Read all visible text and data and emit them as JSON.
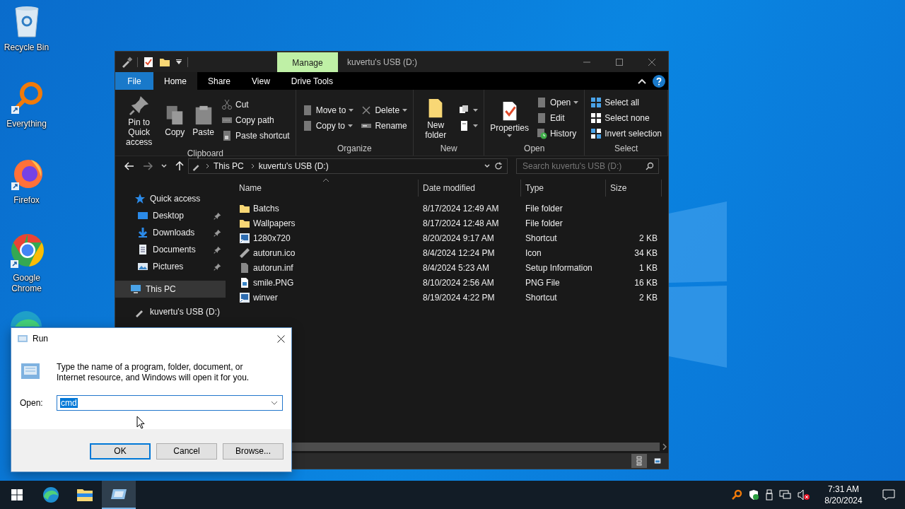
{
  "desktop_icons": [
    {
      "label": "Recycle Bin",
      "kind": "bin"
    },
    {
      "label": "Everything",
      "kind": "search"
    },
    {
      "label": "Firefox",
      "kind": "firefox"
    },
    {
      "label": "Google Chrome",
      "kind": "chrome"
    }
  ],
  "explorer": {
    "context_tab": "Manage",
    "title": "kuvertu's USB (D:)",
    "ribbon_tabs": [
      {
        "label": "File",
        "kind": "file",
        "selected": false
      },
      {
        "label": "Home",
        "kind": "tab",
        "selected": true
      },
      {
        "label": "Share",
        "kind": "tab",
        "selected": false
      },
      {
        "label": "View",
        "kind": "tab",
        "selected": false
      },
      {
        "label": "Drive Tools",
        "kind": "tab",
        "selected": false
      }
    ],
    "ribbon_groups": [
      {
        "name": "Clipboard",
        "columns": [
          [
            {
              "label": "Pin to Quick access",
              "kind": "large",
              "menu": false
            }
          ],
          [
            {
              "label": "Copy",
              "kind": "large",
              "menu": false
            }
          ],
          [
            {
              "label": "Paste",
              "kind": "large",
              "menu": false
            }
          ],
          [
            {
              "label": "Cut",
              "kind": "small",
              "menu": false
            },
            {
              "label": "Copy path",
              "kind": "small",
              "menu": false
            },
            {
              "label": "Paste shortcut",
              "kind": "small",
              "menu": false
            }
          ]
        ]
      },
      {
        "name": "Organize",
        "columns": [
          [
            {
              "label": "Move to",
              "kind": "small",
              "menu": true
            },
            {
              "label": "Copy to",
              "kind": "small",
              "menu": true
            }
          ],
          [
            {
              "label": "Delete",
              "kind": "small",
              "menu": true
            },
            {
              "label": "Rename",
              "kind": "small",
              "menu": false
            }
          ]
        ]
      },
      {
        "name": "New",
        "columns": [
          [
            {
              "label": "New folder",
              "kind": "large",
              "menu": false
            }
          ],
          [
            {
              "kind": "icon",
              "menu": true
            },
            {
              "kind": "icon",
              "menu": true
            }
          ]
        ]
      },
      {
        "name": "Open",
        "columns": [
          [
            {
              "label": "Properties",
              "kind": "large",
              "menu": true
            }
          ],
          [
            {
              "label": "Open",
              "kind": "small",
              "menu": true
            },
            {
              "label": "Edit",
              "kind": "small",
              "menu": false
            },
            {
              "label": "History",
              "kind": "small",
              "menu": false
            }
          ]
        ]
      },
      {
        "name": "Select",
        "columns": [
          [
            {
              "label": "Select all",
              "kind": "small",
              "menu": false
            },
            {
              "label": "Select none",
              "kind": "small",
              "menu": false
            },
            {
              "label": "Invert selection",
              "kind": "small",
              "menu": false
            }
          ]
        ]
      }
    ],
    "breadcrumbs": [
      "This PC",
      "kuvertu's USB (D:)"
    ],
    "search": {
      "placeholder": "Search kuvertu's USB (D:)"
    },
    "nav": [
      {
        "label": "Quick access",
        "selected": false,
        "children": [
          {
            "label": "Desktop",
            "selected": false,
            "pinned": true
          },
          {
            "label": "Downloads",
            "selected": false,
            "pinned": true
          },
          {
            "label": "Documents",
            "selected": false,
            "pinned": true
          },
          {
            "label": "Pictures",
            "selected": false,
            "pinned": true
          }
        ]
      },
      {
        "label": "This PC",
        "selected": true
      },
      {
        "label": "kuvertu's USB (D:)",
        "selected": false
      }
    ],
    "columns": [
      "Name",
      "Date modified",
      "Type",
      "Size"
    ],
    "rows": [
      {
        "kind": "folder",
        "name": "Batchs",
        "date": "8/17/2024 12:49 AM",
        "type": "File folder"
      },
      {
        "kind": "folder",
        "name": "Wallpapers",
        "date": "8/17/2024 12:48 AM",
        "type": "File folder"
      },
      {
        "kind": "shortcut",
        "name": "1280x720",
        "date": "8/20/2024 9:17 AM",
        "type": "Shortcut",
        "size": "2 KB"
      },
      {
        "kind": "icon",
        "name": "autorun.ico",
        "date": "8/4/2024 12:24 PM",
        "type": "Icon",
        "size": "34 KB"
      },
      {
        "kind": "setup",
        "name": "autorun.inf",
        "date": "8/4/2024 5:23 AM",
        "type": "Setup Information",
        "size": "1 KB"
      },
      {
        "kind": "image",
        "name": "smile.PNG",
        "date": "8/10/2024 2:56 AM",
        "type": "PNG File",
        "size": "16 KB"
      },
      {
        "kind": "shortcut",
        "name": "winver",
        "date": "8/19/2024 4:22 PM",
        "type": "Shortcut",
        "size": "2 KB"
      }
    ],
    "views": [
      {
        "selected": true
      },
      {
        "selected": false
      }
    ]
  },
  "run_dialog": {
    "title": "Run",
    "message": "Type the name of a program, folder, document, or Internet resource, and Windows will open it for you.",
    "field_label": "Open:",
    "value": "cmd",
    "buttons": [
      {
        "label": "OK",
        "default": true
      },
      {
        "label": "Cancel",
        "default": false
      },
      {
        "label": "Browse...",
        "default": false
      }
    ]
  },
  "taskbar": {
    "apps": [
      {
        "active": false
      },
      {
        "active": false
      },
      {
        "active": true
      }
    ],
    "time": "7:31 AM",
    "date": "8/20/2024"
  }
}
